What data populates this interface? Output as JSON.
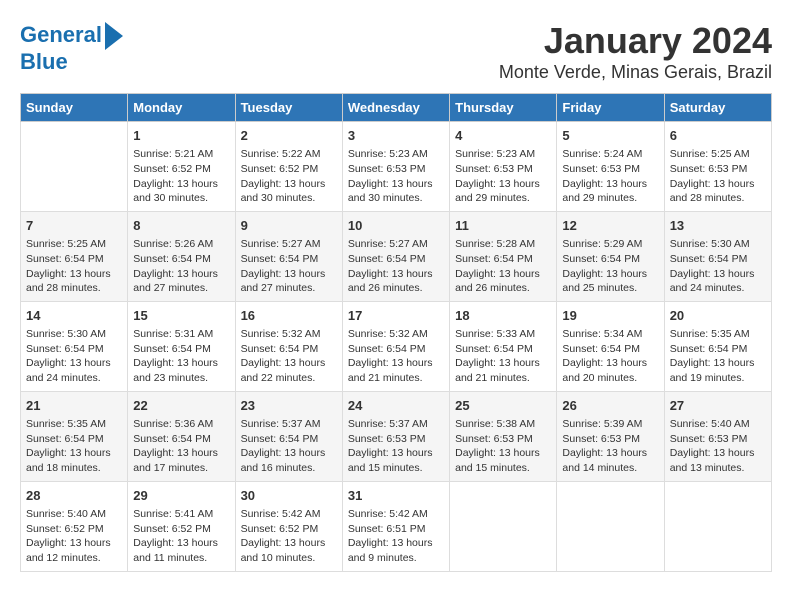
{
  "logo": {
    "line1": "General",
    "line2": "Blue"
  },
  "title": "January 2024",
  "subtitle": "Monte Verde, Minas Gerais, Brazil",
  "days_of_week": [
    "Sunday",
    "Monday",
    "Tuesday",
    "Wednesday",
    "Thursday",
    "Friday",
    "Saturday"
  ],
  "weeks": [
    [
      {
        "day": "",
        "content": ""
      },
      {
        "day": "1",
        "content": "Sunrise: 5:21 AM\nSunset: 6:52 PM\nDaylight: 13 hours\nand 30 minutes."
      },
      {
        "day": "2",
        "content": "Sunrise: 5:22 AM\nSunset: 6:52 PM\nDaylight: 13 hours\nand 30 minutes."
      },
      {
        "day": "3",
        "content": "Sunrise: 5:23 AM\nSunset: 6:53 PM\nDaylight: 13 hours\nand 30 minutes."
      },
      {
        "day": "4",
        "content": "Sunrise: 5:23 AM\nSunset: 6:53 PM\nDaylight: 13 hours\nand 29 minutes."
      },
      {
        "day": "5",
        "content": "Sunrise: 5:24 AM\nSunset: 6:53 PM\nDaylight: 13 hours\nand 29 minutes."
      },
      {
        "day": "6",
        "content": "Sunrise: 5:25 AM\nSunset: 6:53 PM\nDaylight: 13 hours\nand 28 minutes."
      }
    ],
    [
      {
        "day": "7",
        "content": "Sunrise: 5:25 AM\nSunset: 6:54 PM\nDaylight: 13 hours\nand 28 minutes."
      },
      {
        "day": "8",
        "content": "Sunrise: 5:26 AM\nSunset: 6:54 PM\nDaylight: 13 hours\nand 27 minutes."
      },
      {
        "day": "9",
        "content": "Sunrise: 5:27 AM\nSunset: 6:54 PM\nDaylight: 13 hours\nand 27 minutes."
      },
      {
        "day": "10",
        "content": "Sunrise: 5:27 AM\nSunset: 6:54 PM\nDaylight: 13 hours\nand 26 minutes."
      },
      {
        "day": "11",
        "content": "Sunrise: 5:28 AM\nSunset: 6:54 PM\nDaylight: 13 hours\nand 26 minutes."
      },
      {
        "day": "12",
        "content": "Sunrise: 5:29 AM\nSunset: 6:54 PM\nDaylight: 13 hours\nand 25 minutes."
      },
      {
        "day": "13",
        "content": "Sunrise: 5:30 AM\nSunset: 6:54 PM\nDaylight: 13 hours\nand 24 minutes."
      }
    ],
    [
      {
        "day": "14",
        "content": "Sunrise: 5:30 AM\nSunset: 6:54 PM\nDaylight: 13 hours\nand 24 minutes."
      },
      {
        "day": "15",
        "content": "Sunrise: 5:31 AM\nSunset: 6:54 PM\nDaylight: 13 hours\nand 23 minutes."
      },
      {
        "day": "16",
        "content": "Sunrise: 5:32 AM\nSunset: 6:54 PM\nDaylight: 13 hours\nand 22 minutes."
      },
      {
        "day": "17",
        "content": "Sunrise: 5:32 AM\nSunset: 6:54 PM\nDaylight: 13 hours\nand 21 minutes."
      },
      {
        "day": "18",
        "content": "Sunrise: 5:33 AM\nSunset: 6:54 PM\nDaylight: 13 hours\nand 21 minutes."
      },
      {
        "day": "19",
        "content": "Sunrise: 5:34 AM\nSunset: 6:54 PM\nDaylight: 13 hours\nand 20 minutes."
      },
      {
        "day": "20",
        "content": "Sunrise: 5:35 AM\nSunset: 6:54 PM\nDaylight: 13 hours\nand 19 minutes."
      }
    ],
    [
      {
        "day": "21",
        "content": "Sunrise: 5:35 AM\nSunset: 6:54 PM\nDaylight: 13 hours\nand 18 minutes."
      },
      {
        "day": "22",
        "content": "Sunrise: 5:36 AM\nSunset: 6:54 PM\nDaylight: 13 hours\nand 17 minutes."
      },
      {
        "day": "23",
        "content": "Sunrise: 5:37 AM\nSunset: 6:54 PM\nDaylight: 13 hours\nand 16 minutes."
      },
      {
        "day": "24",
        "content": "Sunrise: 5:37 AM\nSunset: 6:53 PM\nDaylight: 13 hours\nand 15 minutes."
      },
      {
        "day": "25",
        "content": "Sunrise: 5:38 AM\nSunset: 6:53 PM\nDaylight: 13 hours\nand 15 minutes."
      },
      {
        "day": "26",
        "content": "Sunrise: 5:39 AM\nSunset: 6:53 PM\nDaylight: 13 hours\nand 14 minutes."
      },
      {
        "day": "27",
        "content": "Sunrise: 5:40 AM\nSunset: 6:53 PM\nDaylight: 13 hours\nand 13 minutes."
      }
    ],
    [
      {
        "day": "28",
        "content": "Sunrise: 5:40 AM\nSunset: 6:52 PM\nDaylight: 13 hours\nand 12 minutes."
      },
      {
        "day": "29",
        "content": "Sunrise: 5:41 AM\nSunset: 6:52 PM\nDaylight: 13 hours\nand 11 minutes."
      },
      {
        "day": "30",
        "content": "Sunrise: 5:42 AM\nSunset: 6:52 PM\nDaylight: 13 hours\nand 10 minutes."
      },
      {
        "day": "31",
        "content": "Sunrise: 5:42 AM\nSunset: 6:51 PM\nDaylight: 13 hours\nand 9 minutes."
      },
      {
        "day": "",
        "content": ""
      },
      {
        "day": "",
        "content": ""
      },
      {
        "day": "",
        "content": ""
      }
    ]
  ]
}
